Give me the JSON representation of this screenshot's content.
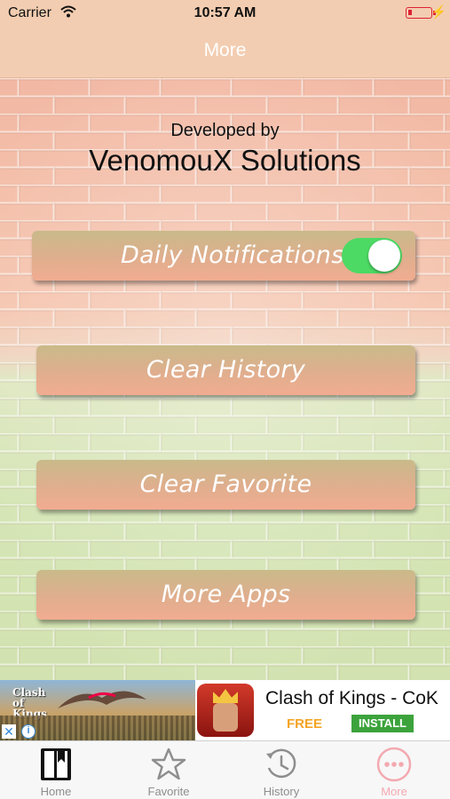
{
  "status_bar": {
    "carrier": "Carrier",
    "time": "10:57 AM"
  },
  "nav": {
    "title": "More"
  },
  "header": {
    "developed_by": "Developed by",
    "company": "VenomouX Solutions"
  },
  "settings": {
    "daily_notifications_label": "Daily Notifications",
    "daily_notifications_on": true,
    "clear_history_label": "Clear History",
    "clear_favorite_label": "Clear Favorite",
    "more_apps_label": "More Apps"
  },
  "ad": {
    "banner_logo": "Clash of Kings",
    "app_name": "Clash of Kings - CoK",
    "price": "FREE",
    "install_label": "INSTALL"
  },
  "tabs": [
    {
      "label": "Home",
      "icon": "book-icon",
      "active": false
    },
    {
      "label": "Favorite",
      "icon": "star-icon",
      "active": false
    },
    {
      "label": "History",
      "icon": "history-clock-icon",
      "active": false
    },
    {
      "label": "More",
      "icon": "more-dots-icon",
      "active": true
    }
  ],
  "colors": {
    "toggle_on": "#4cd964",
    "active_tab": "#f3a9b0",
    "ad_free": "#f4a425",
    "ad_install": "#3ca33c"
  }
}
